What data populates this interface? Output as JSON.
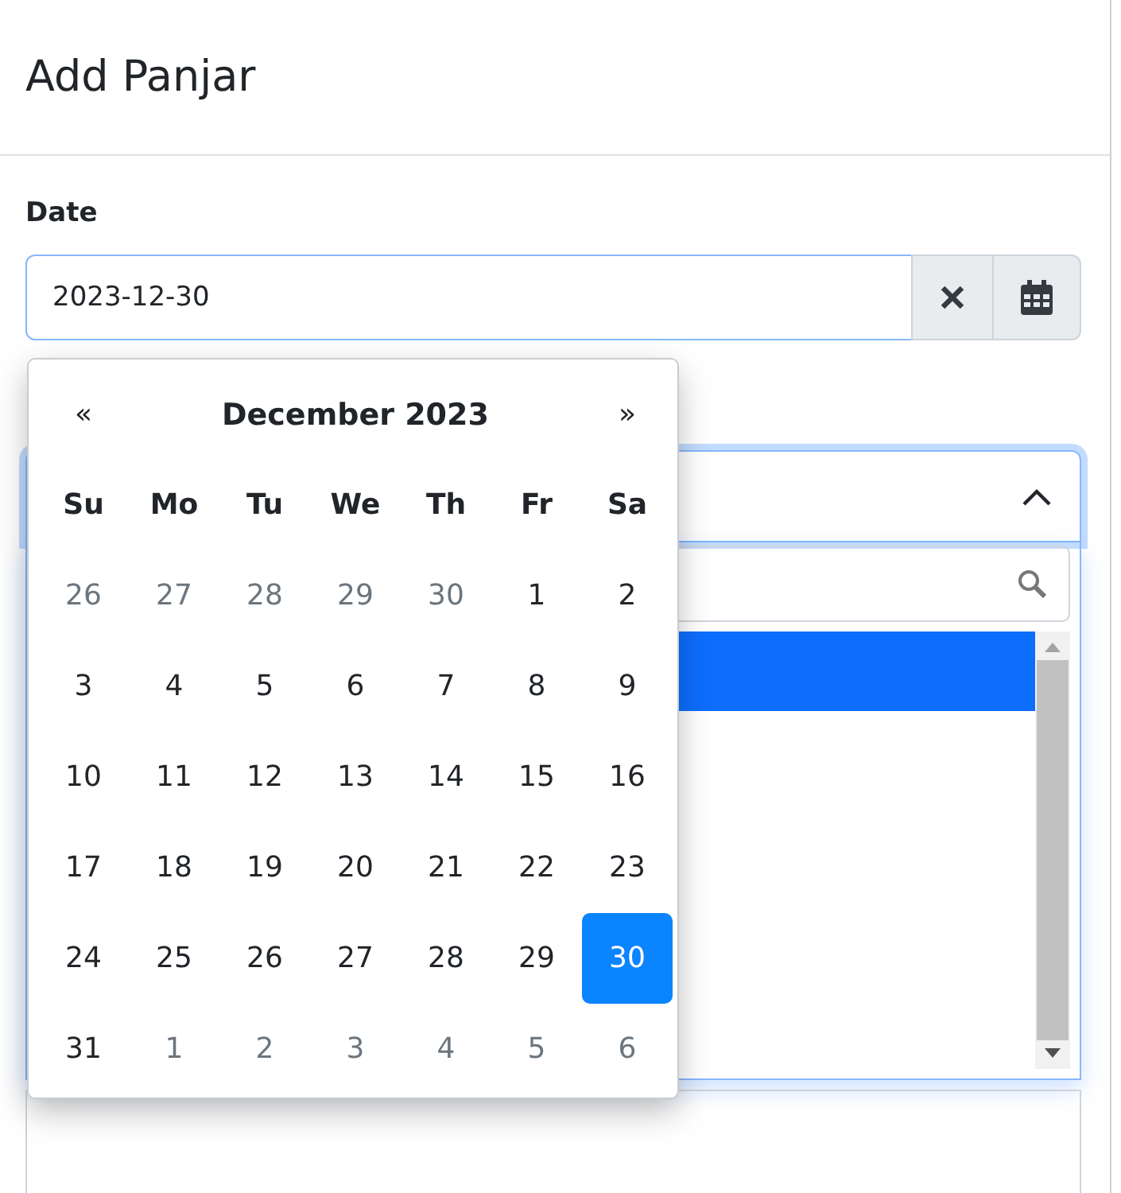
{
  "dialog": {
    "title": "Add Panjar"
  },
  "date_field": {
    "label": "Date",
    "value": "2023-12-30"
  },
  "calendar": {
    "prev": "«",
    "month": "December 2023",
    "next": "»",
    "weekdays": [
      "Su",
      "Mo",
      "Tu",
      "We",
      "Th",
      "Fr",
      "Sa"
    ],
    "days": [
      {
        "label": "26",
        "muted": true,
        "selected": false
      },
      {
        "label": "27",
        "muted": true,
        "selected": false
      },
      {
        "label": "28",
        "muted": true,
        "selected": false
      },
      {
        "label": "29",
        "muted": true,
        "selected": false
      },
      {
        "label": "30",
        "muted": true,
        "selected": false
      },
      {
        "label": "1",
        "muted": false,
        "selected": false
      },
      {
        "label": "2",
        "muted": false,
        "selected": false
      },
      {
        "label": "3",
        "muted": false,
        "selected": false
      },
      {
        "label": "4",
        "muted": false,
        "selected": false
      },
      {
        "label": "5",
        "muted": false,
        "selected": false
      },
      {
        "label": "6",
        "muted": false,
        "selected": false
      },
      {
        "label": "7",
        "muted": false,
        "selected": false
      },
      {
        "label": "8",
        "muted": false,
        "selected": false
      },
      {
        "label": "9",
        "muted": false,
        "selected": false
      },
      {
        "label": "10",
        "muted": false,
        "selected": false
      },
      {
        "label": "11",
        "muted": false,
        "selected": false
      },
      {
        "label": "12",
        "muted": false,
        "selected": false
      },
      {
        "label": "13",
        "muted": false,
        "selected": false
      },
      {
        "label": "14",
        "muted": false,
        "selected": false
      },
      {
        "label": "15",
        "muted": false,
        "selected": false
      },
      {
        "label": "16",
        "muted": false,
        "selected": false
      },
      {
        "label": "17",
        "muted": false,
        "selected": false
      },
      {
        "label": "18",
        "muted": false,
        "selected": false
      },
      {
        "label": "19",
        "muted": false,
        "selected": false
      },
      {
        "label": "20",
        "muted": false,
        "selected": false
      },
      {
        "label": "21",
        "muted": false,
        "selected": false
      },
      {
        "label": "22",
        "muted": false,
        "selected": false
      },
      {
        "label": "23",
        "muted": false,
        "selected": false
      },
      {
        "label": "24",
        "muted": false,
        "selected": false
      },
      {
        "label": "25",
        "muted": false,
        "selected": false
      },
      {
        "label": "26",
        "muted": false,
        "selected": false
      },
      {
        "label": "27",
        "muted": false,
        "selected": false
      },
      {
        "label": "28",
        "muted": false,
        "selected": false
      },
      {
        "label": "29",
        "muted": false,
        "selected": false
      },
      {
        "label": "30",
        "muted": false,
        "selected": true
      },
      {
        "label": "31",
        "muted": false,
        "selected": false
      },
      {
        "label": "1",
        "muted": true,
        "selected": false
      },
      {
        "label": "2",
        "muted": true,
        "selected": false
      },
      {
        "label": "3",
        "muted": true,
        "selected": false
      },
      {
        "label": "4",
        "muted": true,
        "selected": false
      },
      {
        "label": "5",
        "muted": true,
        "selected": false
      },
      {
        "label": "6",
        "muted": true,
        "selected": false
      }
    ]
  },
  "select": {
    "expanded": true,
    "options": [
      {
        "selected": true
      }
    ]
  }
}
